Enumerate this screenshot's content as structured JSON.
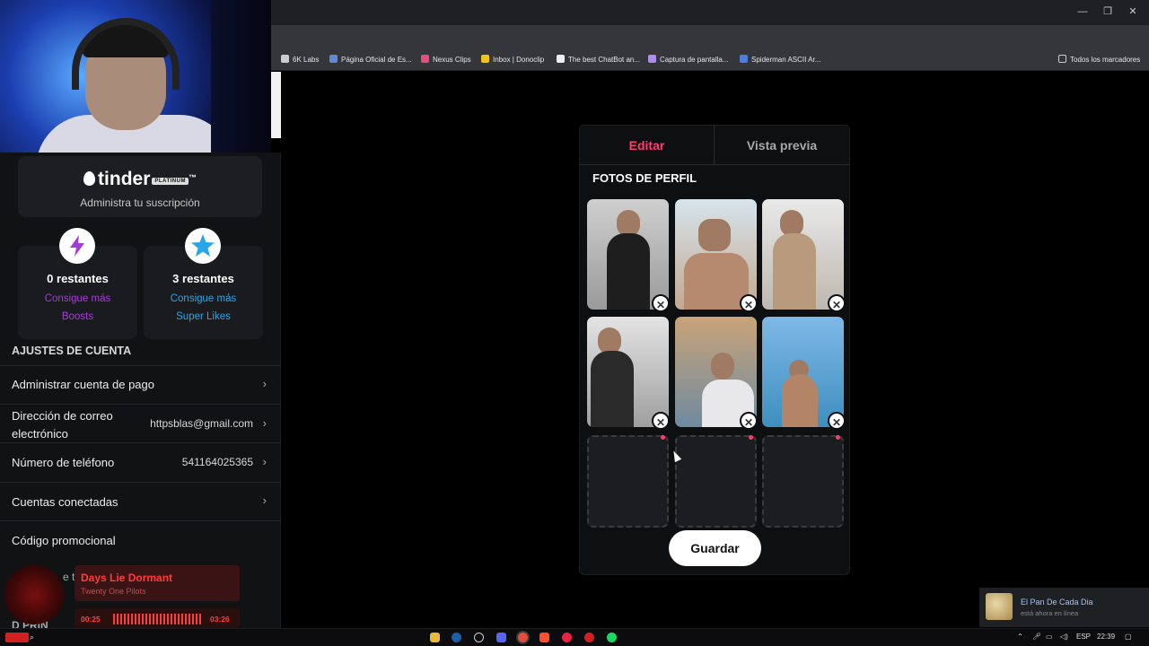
{
  "browser": {
    "bookmarks": [
      "6K Labs",
      "Página Oficial de Es...",
      "Nexus Clips",
      "Inbox | Donoclip",
      "The best ChatBot an...",
      "Captura de pantalla...",
      "Spiderman ASCII Ar..."
    ],
    "all_bookmarks": "Todos los marcadores"
  },
  "subscription": {
    "brand": "tinder",
    "tier": "PLATINUM",
    "trademark": "™",
    "manage": "Administra tu suscripción"
  },
  "boosts": {
    "count": "0 restantes",
    "link1": "Consigue más",
    "link2": "Boosts",
    "color": "#a53bd9"
  },
  "superlikes": {
    "count": "3 restantes",
    "link1": "Consigue más",
    "link2": "Super Likes",
    "color": "#27a6e8"
  },
  "account": {
    "section_title": "AJUSTES DE CUENTA",
    "payment": "Administrar cuenta de pago",
    "email_label_1": "Dirección de correo",
    "email_label_2": "electrónico",
    "email_value": "httpsblas@gmail.com",
    "phone_label": "Número de teléfono",
    "phone_value": "541164025365",
    "connected": "Cuentas conectadas",
    "promo": "Código promocional"
  },
  "editor": {
    "tab_edit": "Editar",
    "tab_preview": "Vista previa",
    "section": "FOTOS DE PERFIL",
    "save": "Guardar",
    "accent": "#fe3c72"
  },
  "music": {
    "song": "Days Lie Dormant",
    "artist": "Twenty One Pilots",
    "elapsed": "00:25",
    "total": "03:26",
    "partial_behind_1": "e t",
    "partial_behind_2": "D PRIN"
  },
  "notification": {
    "title": "El Pan De Cada Dia",
    "subtitle": "está ahora en línea"
  },
  "taskbar": {
    "language": "ESP",
    "time": "22:39"
  }
}
